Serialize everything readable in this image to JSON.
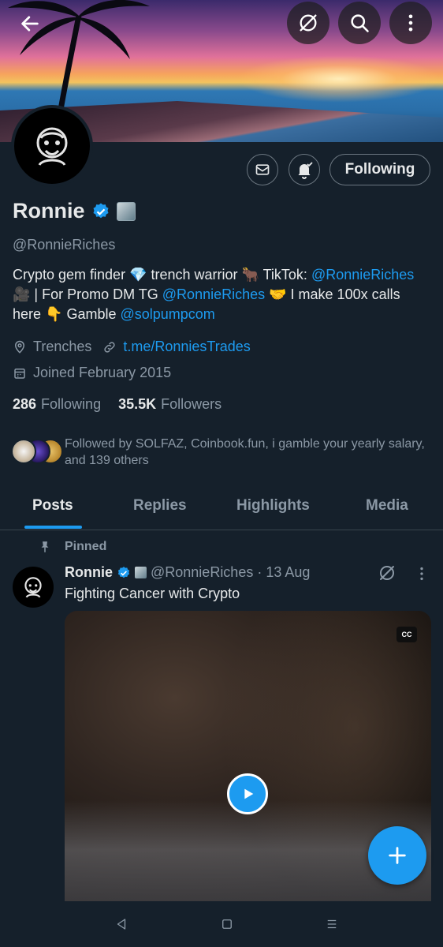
{
  "profile": {
    "name": "Ronnie",
    "handle": "@RonnieRiches",
    "bio_parts": {
      "p1": "Crypto gem finder 💎 trench warrior 🐂 TikTok: ",
      "link1": "@RonnieRiches",
      "p2": " 🎥 | For Promo DM TG ",
      "link2": "@RonnieRiches",
      "p3": " 🤝 I make 100x calls here 👇 Gamble ",
      "link3": "@solpumpcom"
    },
    "location": "Trenches",
    "website": "t.me/RonniesTrades",
    "joined": "Joined February 2015",
    "following_count": "286",
    "following_label": "Following",
    "followers_count": "35.5K",
    "followers_label": "Followers",
    "followed_by": "Followed by SOLFAZ, Coinbook.fun, i gamble your yearly salary, and 139 others"
  },
  "actions": {
    "following_button": "Following"
  },
  "tabs": [
    {
      "label": "Posts"
    },
    {
      "label": "Replies"
    },
    {
      "label": "Highlights"
    },
    {
      "label": "Media"
    }
  ],
  "pinned_post": {
    "pinned_label": "Pinned",
    "author": "Ronnie",
    "handle_date": "@RonnieRiches · 13 Aug",
    "text": "Fighting Cancer with Crypto",
    "cc_label": "CC"
  },
  "colors": {
    "background": "#15202b",
    "accent": "#1d9bf0",
    "secondary_text": "#8b98a5"
  },
  "icons": [
    "back-arrow-icon",
    "grok-icon",
    "search-icon",
    "more-vertical-icon",
    "mail-icon",
    "bell-icon",
    "verified-badge-icon",
    "location-icon",
    "link-icon",
    "calendar-icon",
    "pin-icon",
    "play-icon",
    "plus-icon"
  ]
}
